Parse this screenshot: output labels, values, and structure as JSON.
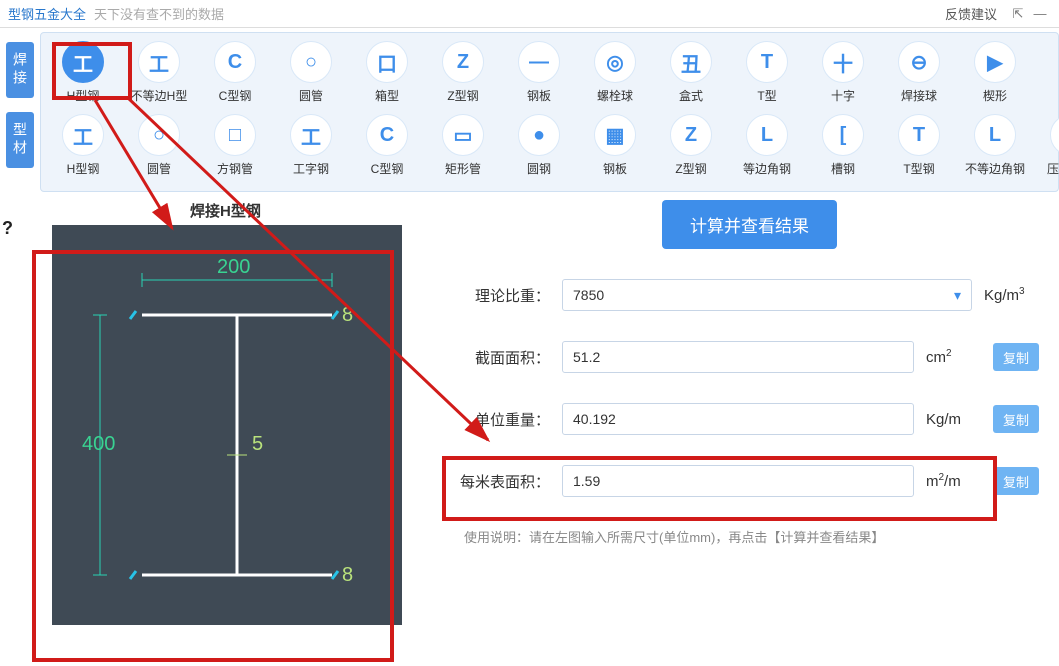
{
  "header": {
    "app_title": "型钢五金大全",
    "subtitle": "天下没有查不到的数据",
    "feedback": "反馈建议"
  },
  "side_tabs": [
    "焊接",
    "型材"
  ],
  "ribbon_row1": [
    {
      "label": "H型钢",
      "glyph": "工",
      "selected": true
    },
    {
      "label": "不等边H型",
      "glyph": "工"
    },
    {
      "label": "C型钢",
      "glyph": "C"
    },
    {
      "label": "圆管",
      "glyph": "○"
    },
    {
      "label": "箱型",
      "glyph": "口"
    },
    {
      "label": "Z型钢",
      "glyph": "Z"
    },
    {
      "label": "钢板",
      "glyph": "—"
    },
    {
      "label": "螺栓球",
      "glyph": "◎"
    },
    {
      "label": "盒式",
      "glyph": "丑"
    },
    {
      "label": "T型",
      "glyph": "T"
    },
    {
      "label": "十字",
      "glyph": "十"
    },
    {
      "label": "焊接球",
      "glyph": "⊖"
    },
    {
      "label": "楔形",
      "glyph": "▶"
    }
  ],
  "ribbon_row2": [
    {
      "label": "H型钢",
      "glyph": "工"
    },
    {
      "label": "圆管",
      "glyph": "○"
    },
    {
      "label": "方钢管",
      "glyph": "□"
    },
    {
      "label": "工字钢",
      "glyph": "工"
    },
    {
      "label": "C型钢",
      "glyph": "C"
    },
    {
      "label": "矩形管",
      "glyph": "▭"
    },
    {
      "label": "圆钢",
      "glyph": "●"
    },
    {
      "label": "钢板",
      "glyph": "▦"
    },
    {
      "label": "Z型钢",
      "glyph": "Z"
    },
    {
      "label": "等边角钢",
      "glyph": "L"
    },
    {
      "label": "槽钢",
      "glyph": "["
    },
    {
      "label": "T型钢",
      "glyph": "T"
    },
    {
      "label": "不等边角钢",
      "glyph": "L"
    },
    {
      "label": "压型钢板",
      "glyph": "◆"
    }
  ],
  "diagram": {
    "title": "焊接H型钢",
    "dim_width": "200",
    "dim_height": "400",
    "dim_web": "5",
    "dim_flange_top": "8",
    "dim_flange_bot": "8"
  },
  "form": {
    "calc_button": "计算并查看结果",
    "density_label": "理论比重：",
    "density_value": "7850",
    "density_unit_html": "Kg/m³",
    "area_label": "截面面积：",
    "area_value": "51.2",
    "area_unit_html": "cm²",
    "weight_label": "单位重量：",
    "weight_value": "40.192",
    "weight_unit_html": "Kg/m",
    "surface_label": "每米表面积：",
    "surface_value": "1.59",
    "surface_unit_html": "m²/m",
    "copy_label": "复制",
    "help_text": "使用说明：请在左图输入所需尺寸(单位mm)，再点击【计算并查看结果】"
  }
}
